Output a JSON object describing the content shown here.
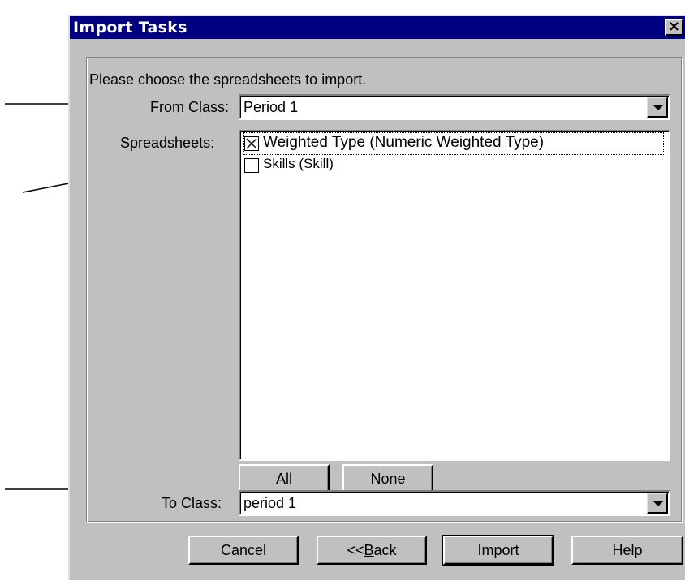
{
  "window": {
    "title": "Import Tasks",
    "close_glyph": "×"
  },
  "instructions": "Please choose the spreadsheets to import.",
  "from_class": {
    "label": "From Class:",
    "value": "Period 1"
  },
  "spreadsheets": {
    "label": "Spreadsheets:",
    "items": [
      {
        "label": "Weighted Type (Numeric Weighted Type)",
        "checked": true
      },
      {
        "label": "Skills (Skill)",
        "checked": false
      }
    ]
  },
  "select_buttons": {
    "all": "All",
    "none": "None"
  },
  "to_class": {
    "label": "To Class:",
    "value": "period 1"
  },
  "footer": {
    "cancel": "Cancel",
    "back_prefix": "<<",
    "back_key": "B",
    "back_rest": "ack",
    "import": "Import",
    "help": "Help"
  },
  "colors": {
    "titlebar": "#000080",
    "face": "#c0c0c0",
    "annotation": "#000000"
  }
}
